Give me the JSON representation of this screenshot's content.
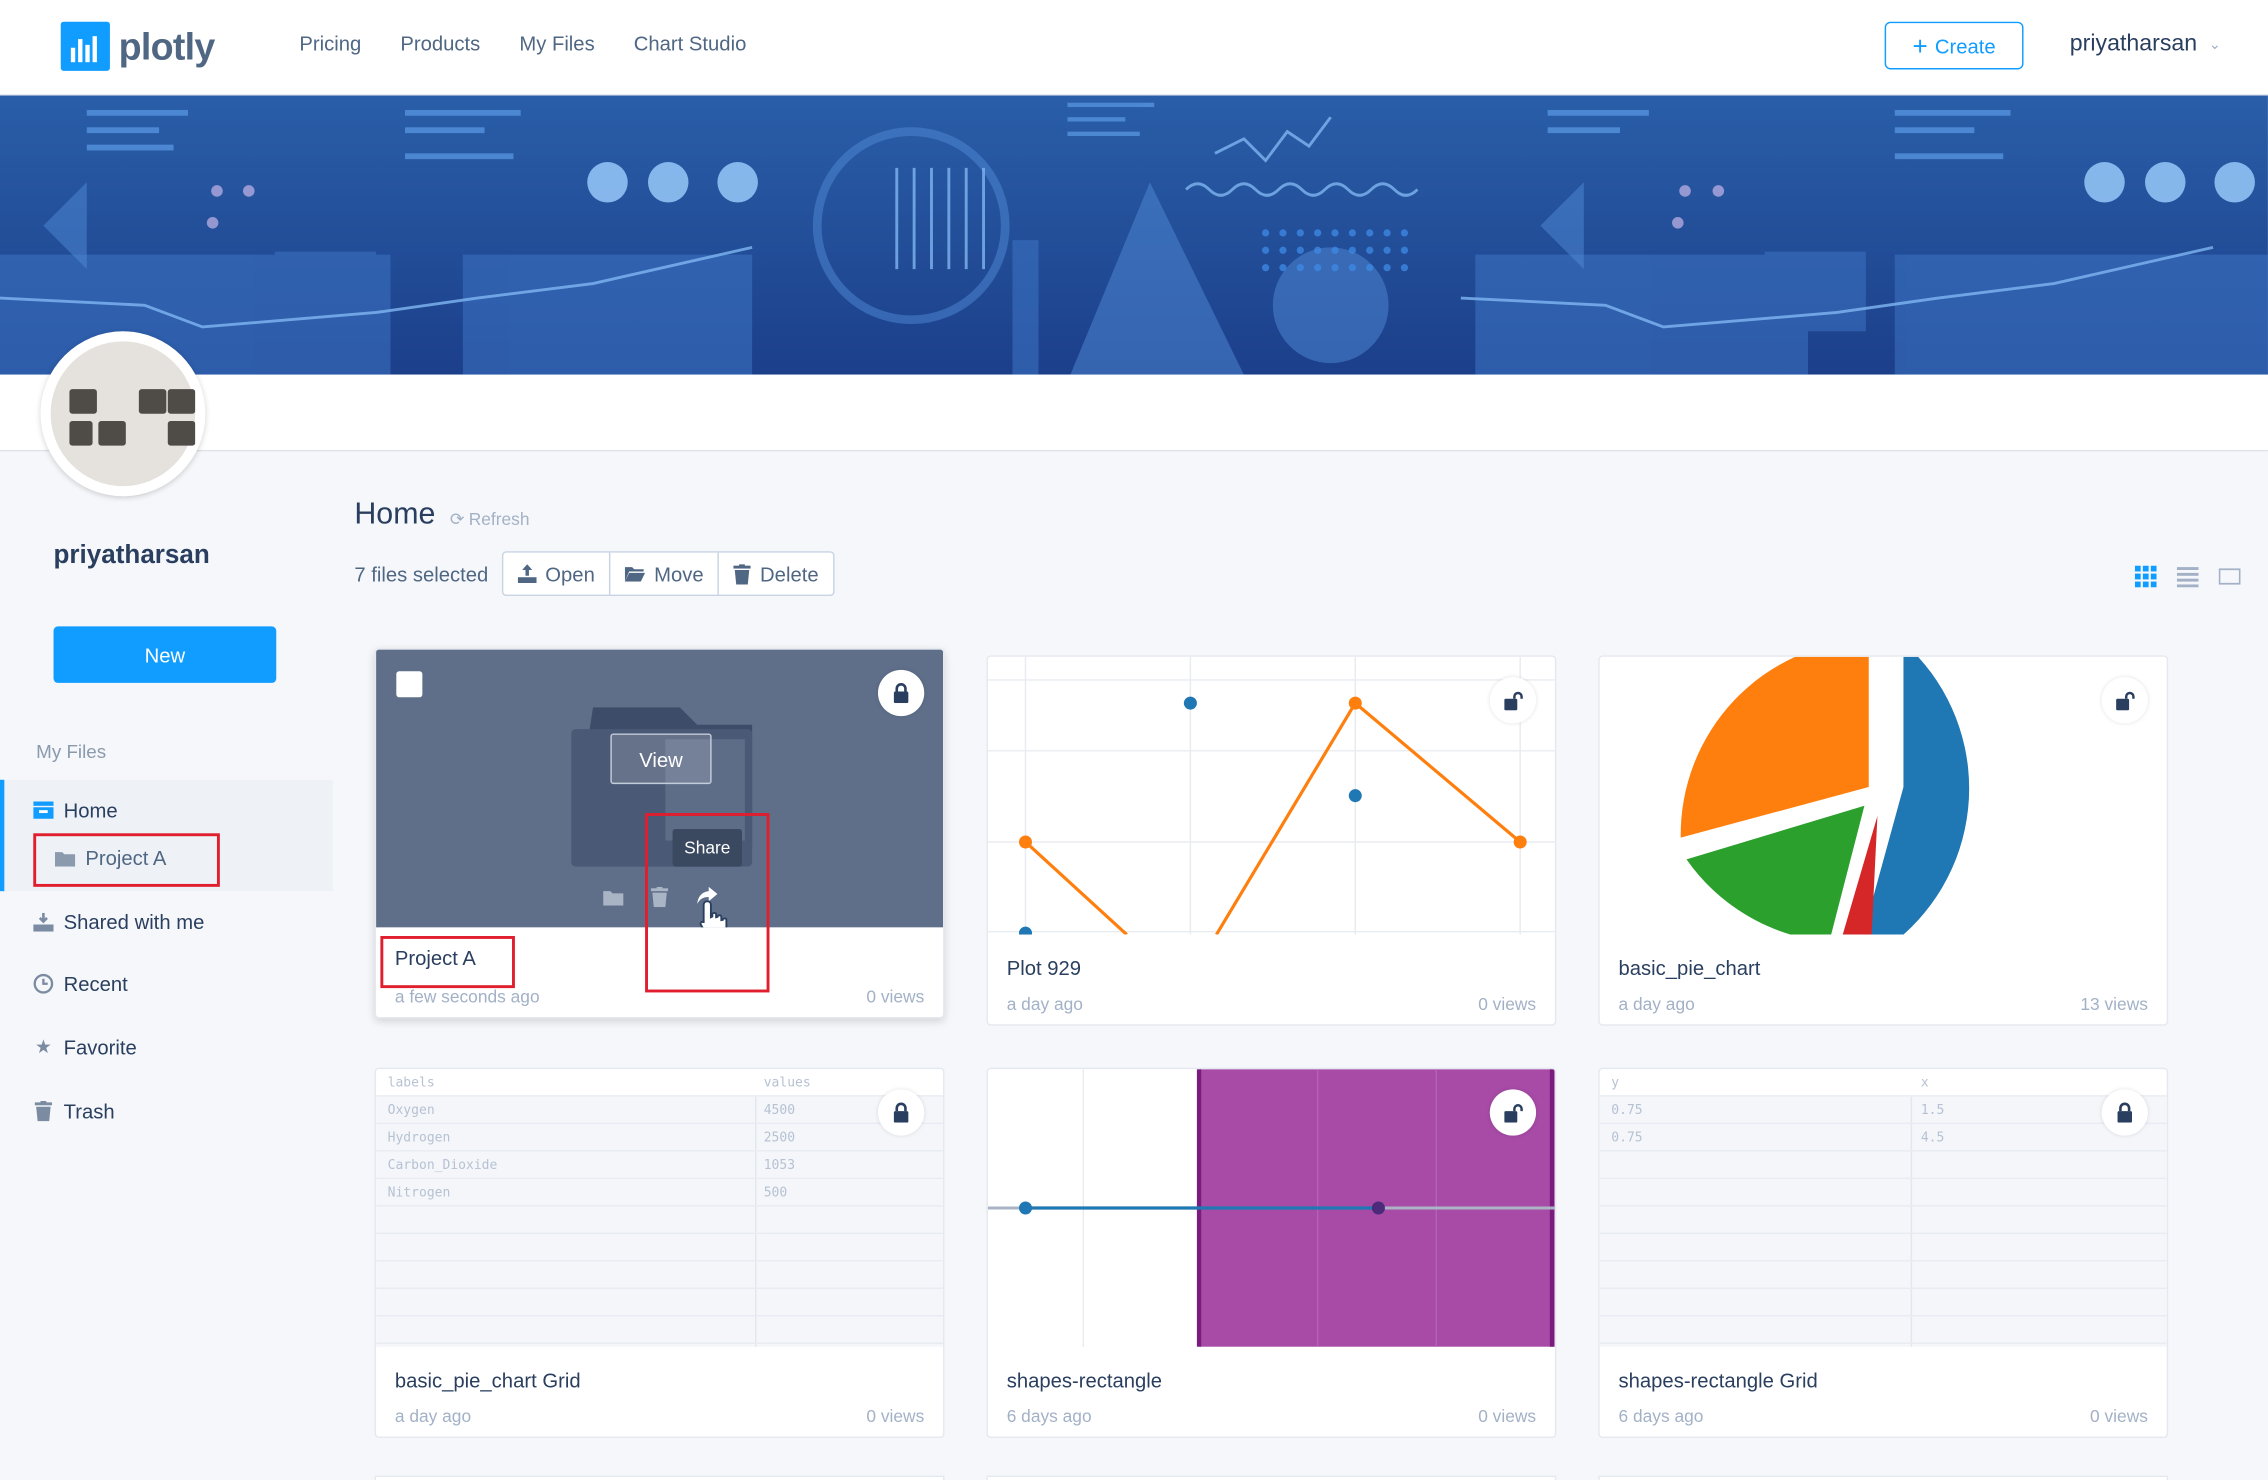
{
  "app": {
    "logo_text": "plotly"
  },
  "nav": {
    "links": [
      "Pricing",
      "Products",
      "My Files",
      "Chart Studio"
    ],
    "create_label": "Create",
    "username": "priyatharsan"
  },
  "sidebar": {
    "username": "priyatharsan",
    "new_label": "New",
    "section_label": "My Files",
    "items": [
      {
        "label": "Home",
        "icon": "inbox-icon"
      },
      {
        "label": "Project A",
        "icon": "folder-icon"
      },
      {
        "label": "Shared with me",
        "icon": "share-download-icon"
      },
      {
        "label": "Recent",
        "icon": "clock-icon"
      },
      {
        "label": "Favorite",
        "icon": "star-icon"
      },
      {
        "label": "Trash",
        "icon": "trash-icon"
      }
    ]
  },
  "main": {
    "title": "Home",
    "refresh_label": "Refresh",
    "selected_count": "7 files selected",
    "actions": {
      "open": "Open",
      "move": "Move",
      "delete": "Delete"
    },
    "hover": {
      "view_label": "View",
      "tooltip": "Share"
    }
  },
  "files": [
    {
      "name": "Project A",
      "date": "a few seconds ago",
      "views": "0 views",
      "type": "folder",
      "locked": true
    },
    {
      "name": "Plot 929",
      "date": "a day ago",
      "views": "0 views",
      "type": "line-plot",
      "locked": false
    },
    {
      "name": "basic_pie_chart",
      "date": "a day ago",
      "views": "13 views",
      "type": "pie-plot",
      "locked": false
    },
    {
      "name": "basic_pie_chart Grid",
      "date": "a day ago",
      "views": "0 views",
      "type": "grid",
      "locked": true,
      "grid": {
        "headers": [
          "labels",
          "values"
        ],
        "rows": [
          [
            "Oxygen",
            "4500"
          ],
          [
            "Hydrogen",
            "2500"
          ],
          [
            "Carbon_Dioxide",
            "1053"
          ],
          [
            "Nitrogen",
            "500"
          ]
        ]
      }
    },
    {
      "name": "shapes-rectangle",
      "date": "6 days ago",
      "views": "0 views",
      "type": "shape-plot",
      "locked": false
    },
    {
      "name": "shapes-rectangle Grid",
      "date": "6 days ago",
      "views": "0 views",
      "type": "grid",
      "locked": true,
      "grid": {
        "headers": [
          "y",
          "x"
        ],
        "rows": [
          [
            "0.75",
            "1.5"
          ],
          [
            "0.75",
            "4.5"
          ]
        ]
      }
    }
  ],
  "colors": {
    "accent": "#119dff",
    "navy": "#2a3f5f",
    "highlight": "#e01e2e",
    "orange": "#ff7f0e",
    "blue": "#1f77b4",
    "green": "#2ca02c",
    "red": "#d62728",
    "purple": "#9b3a9e"
  }
}
